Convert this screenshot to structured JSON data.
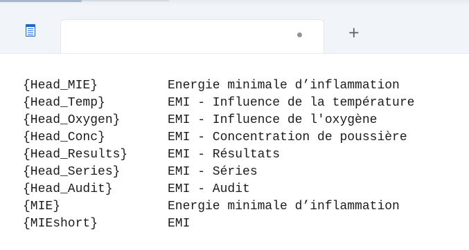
{
  "window": {
    "tab_title": "",
    "new_tab_symbol": "+"
  },
  "editor": {
    "rows": [
      {
        "key": "{Head_MIE}",
        "value": "Energie minimale d’inflammation"
      },
      {
        "key": "{Head_Temp}",
        "value": "EMI - Influence de la température"
      },
      {
        "key": "{Head_Oxygen}",
        "value": "EMI - Influence de l'oxygène"
      },
      {
        "key": "{Head_Conc}",
        "value": "EMI - Concentration de poussière"
      },
      {
        "key": "{Head_Results}",
        "value": "EMI - Résultats"
      },
      {
        "key": "{Head_Series}",
        "value": "EMI - Séries"
      },
      {
        "key": "{Head_Audit}",
        "value": "EMI - Audit"
      },
      {
        "key": "{MIE}",
        "value": "Energie minimale d’inflammation"
      },
      {
        "key": "{MIEshort}",
        "value": "EMI"
      }
    ]
  },
  "icons": {
    "app": "notepad-icon",
    "unsaved": "unsaved-dot-icon",
    "new_tab": "plus-icon"
  },
  "colors": {
    "chrome_background": "#f1f4f8",
    "editor_background": "#ffffff",
    "text": "#1b1b1b",
    "accent": "#1f67cf"
  }
}
